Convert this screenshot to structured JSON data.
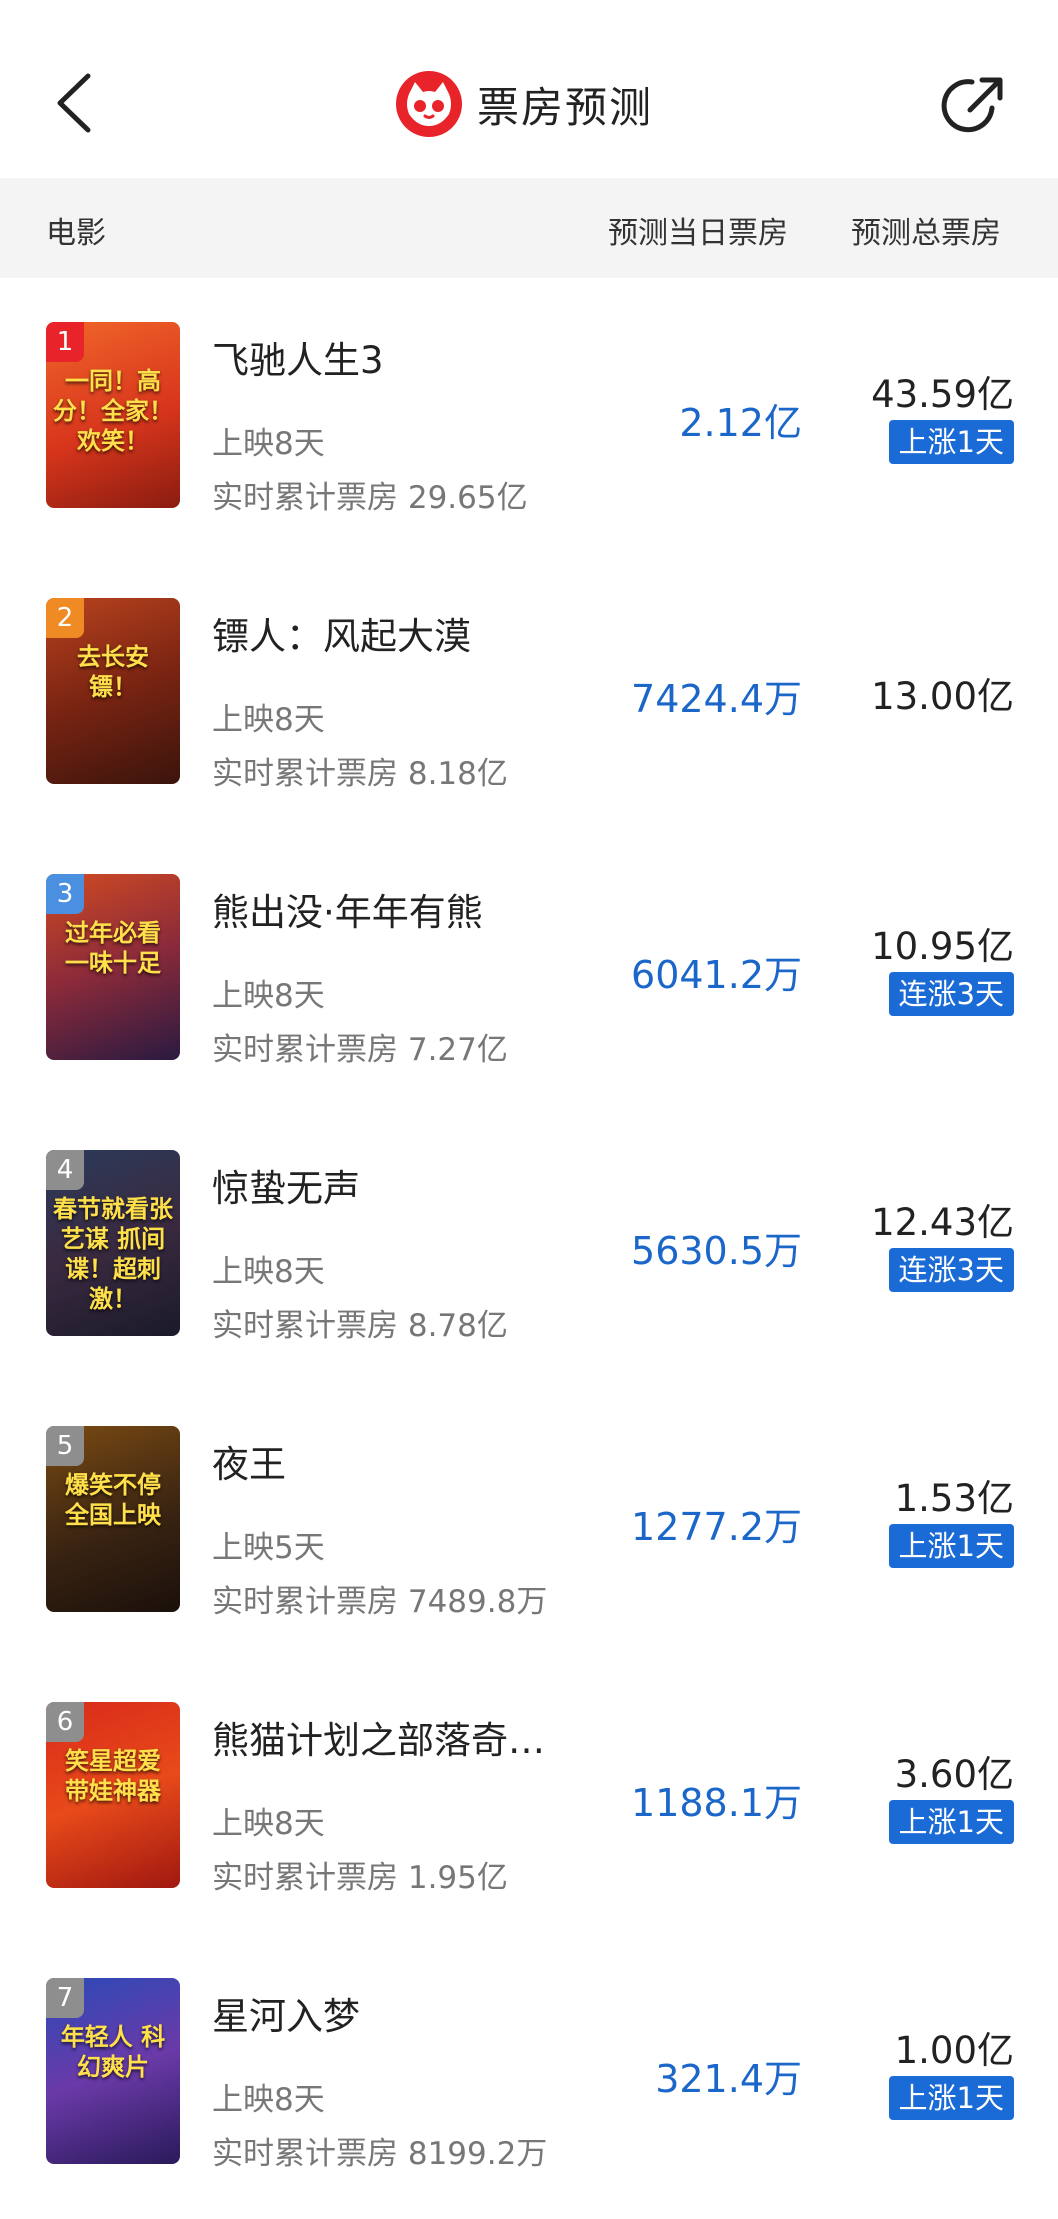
{
  "header": {
    "title": "票房预测",
    "back_icon": "chevron-left-icon",
    "share_icon": "share-icon",
    "logo_icon": "cat-logo-icon",
    "brand_color": "#e8242a"
  },
  "columns": {
    "movie": "电影",
    "day_forecast": "预测当日票房",
    "total_forecast": "预测总票房"
  },
  "colors": {
    "accent": "#1b66c9",
    "badge": "#1b6bd6"
  },
  "movies": [
    {
      "rank": "1",
      "name": "飞驰人生3",
      "days": "上映8天",
      "cumulative": "实时累计票房 29.65亿",
      "day_forecast": "2.12亿",
      "total_forecast": "43.59亿",
      "trend": "上涨1天",
      "rank_color": "#e8242a"
    },
    {
      "rank": "2",
      "name": "镖人：风起大漠",
      "days": "上映8天",
      "cumulative": "实时累计票房 8.18亿",
      "day_forecast": "7424.4万",
      "total_forecast": "13.00亿",
      "trend": "",
      "rank_color": "#f08a24"
    },
    {
      "rank": "3",
      "name": "熊出没·年年有熊",
      "days": "上映8天",
      "cumulative": "实时累计票房 7.27亿",
      "day_forecast": "6041.2万",
      "total_forecast": "10.95亿",
      "trend": "连涨3天",
      "rank_color": "#4a8fe0"
    },
    {
      "rank": "4",
      "name": "惊蛰无声",
      "days": "上映8天",
      "cumulative": "实时累计票房 8.78亿",
      "day_forecast": "5630.5万",
      "total_forecast": "12.43亿",
      "trend": "连涨3天",
      "rank_color": "#8e8e8e"
    },
    {
      "rank": "5",
      "name": "夜王",
      "days": "上映5天",
      "cumulative": "实时累计票房 7489.8万",
      "day_forecast": "1277.2万",
      "total_forecast": "1.53亿",
      "trend": "上涨1天",
      "rank_color": "#8e8e8e"
    },
    {
      "rank": "6",
      "name": "熊猫计划之部落奇…",
      "days": "上映8天",
      "cumulative": "实时累计票房 1.95亿",
      "day_forecast": "1188.1万",
      "total_forecast": "3.60亿",
      "trend": "上涨1天",
      "rank_color": "#8e8e8e"
    },
    {
      "rank": "7",
      "name": "星河入梦",
      "days": "上映8天",
      "cumulative": "实时累计票房 8199.2万",
      "day_forecast": "321.4万",
      "total_forecast": "1.00亿",
      "trend": "上涨1天",
      "rank_color": "#8e8e8e"
    }
  ],
  "posters": [
    {
      "text": "一同！高分！全家！欢笑！",
      "bg": "linear-gradient(160deg,#f0662a 0%,#d8361c 55%,#8a1c10 100%)"
    },
    {
      "text": "去长安 镖！",
      "bg": "linear-gradient(160deg,#b8431e 0%,#7a2412 50%,#3a140c 100%)"
    },
    {
      "text": "过年必看 一味十足",
      "bg": "linear-gradient(160deg,#d04a22 0%,#8a2a3a 50%,#2a1a40 100%)"
    },
    {
      "text": "春节就看张艺谋 抓间谍！超刺激！",
      "bg": "linear-gradient(160deg,#2a3a5a 0%,#3a2a40 50%,#1a1a2a 100%)"
    },
    {
      "text": "爆笑不停 全国上映",
      "bg": "linear-gradient(160deg,#7a4a12 0%,#3a2412 55%,#1a100a 100%)"
    },
    {
      "text": "笑星超爱 带娃神器",
      "bg": "linear-gradient(160deg,#d82a1a 0%,#e84a1a 50%,#a01810 100%)"
    },
    {
      "text": "年轻人 科幻爽片",
      "bg": "linear-gradient(160deg,#2a4ab8 0%,#6a3aa8 50%,#2a1a5a 100%)"
    }
  ]
}
